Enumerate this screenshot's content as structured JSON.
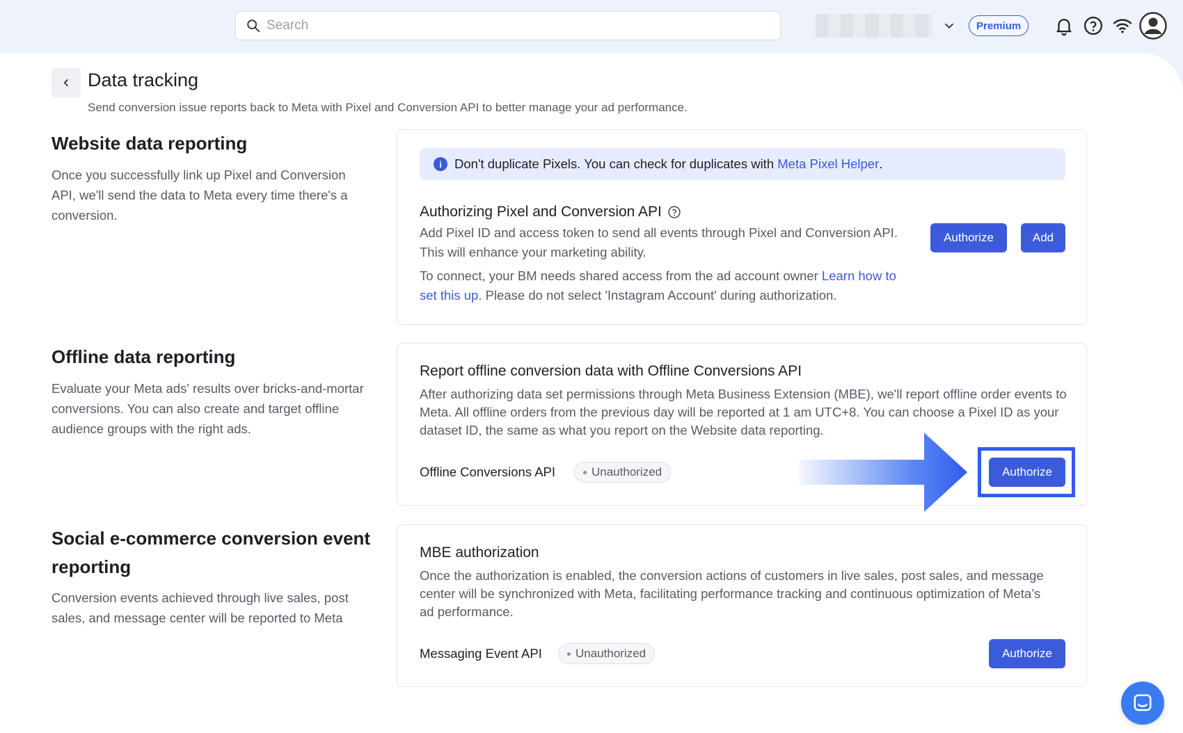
{
  "search": {
    "placeholder": "Search"
  },
  "header": {
    "premium_label": "Premium"
  },
  "page": {
    "title": "Data tracking",
    "subtitle": "Send conversion issue reports back to Meta with Pixel and Conversion API to better manage your ad performance."
  },
  "website": {
    "heading": "Website data reporting",
    "description": "Once you successfully link up Pixel and Conversion API, we'll send the data to Meta every time there's a conversion.",
    "banner_text": "Don't duplicate Pixels. You can check for duplicates with ",
    "banner_link": "Meta Pixel Helper",
    "banner_end": ".",
    "card_title": "Authorizing Pixel and Conversion API",
    "card_desc": "Add Pixel ID and access token to send all events through Pixel and Conversion API. This will enhance your marketing ability.",
    "connect_text": "To connect, your BM needs shared access from the ad account owner ",
    "connect_link": "Learn how to set this up",
    "connect_end": ". Please do not select 'Instagram Account' during authorization.",
    "authorize_label": "Authorize",
    "add_label": "Add"
  },
  "offline": {
    "heading": "Offline data reporting",
    "description": "Evaluate your Meta ads' results over bricks-and-mortar conversions. You can also create and target offline audience groups with the right ads.",
    "card_title": "Report offline conversion data with Offline Conversions API",
    "card_desc": "After authorizing data set permissions through Meta Business Extension (MBE), we'll report offline order events to Meta. All offline orders from the previous day will be reported at 1 am UTC+8. You can choose a Pixel ID as your dataset ID, the same as what you report on the Website data reporting.",
    "api_label": "Offline Conversions API",
    "status": "Unauthorized",
    "authorize_label": "Authorize"
  },
  "social": {
    "heading": "Social e-commerce conversion event reporting",
    "description": "Conversion events achieved through live sales, post sales, and message center will be reported to Meta",
    "card_title": "MBE authorization",
    "card_desc": "Once the authorization is enabled, the conversion actions of customers in live sales, post sales, and message center will be synchronized with Meta, facilitating performance tracking and continuous optimization of Meta’s ad performance.",
    "api_label": "Messaging Event API",
    "status": "Unauthorized",
    "authorize_label": "Authorize"
  },
  "colors": {
    "accent": "#3b5bdb",
    "highlight": "#2e5bf0",
    "chat": "#3a7bf0"
  }
}
